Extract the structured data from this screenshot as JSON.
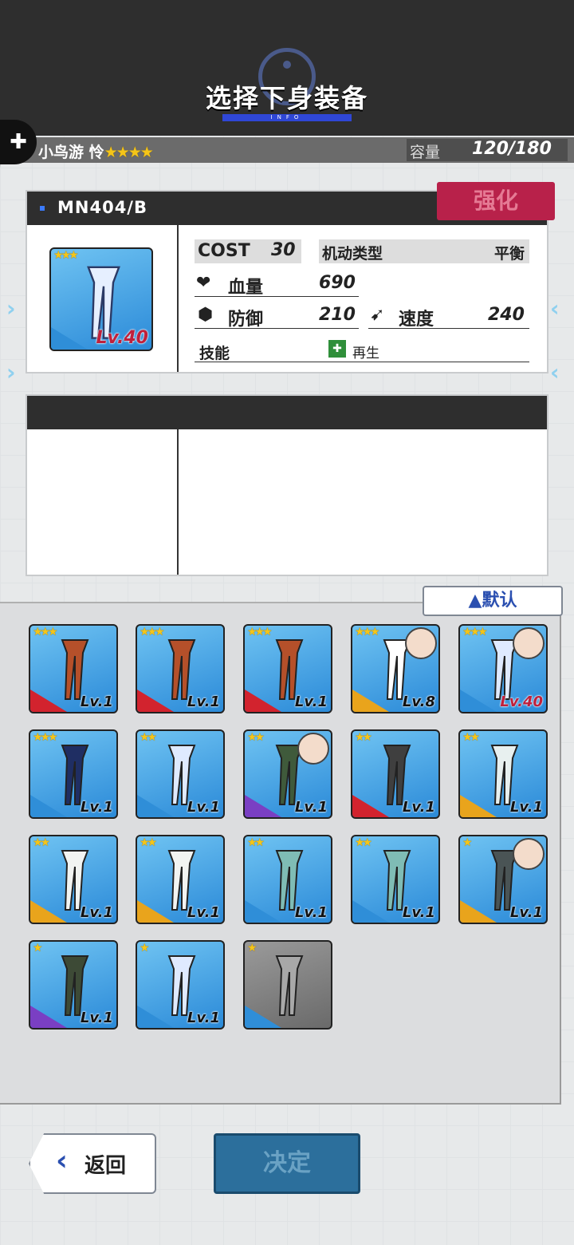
{
  "header": {
    "title": "选择下身装备",
    "subtitle": "INFO"
  },
  "pilot": {
    "name": "小鸟游 怜",
    "stars": "★★★★"
  },
  "capacity": {
    "label": "容量",
    "value": "120/180"
  },
  "detail": {
    "name": "MN404/B",
    "strengthen_label": "强化",
    "level": "Lv.40",
    "rarity": "★★★",
    "cost_label": "COST",
    "cost_value": "30",
    "mobility_label": "机动类型",
    "mobility_value": "平衡",
    "hp_label": "血量",
    "hp_value": "690",
    "def_label": "防御",
    "def_value": "210",
    "speed_label": "速度",
    "speed_value": "240",
    "skill_label": "技能",
    "skill_value": "再生"
  },
  "sort": {
    "label": "▲默认"
  },
  "items": [
    {
      "rarity": "★★★",
      "level": "Lv.1",
      "mark": "#d2232e",
      "color": "#b5502a",
      "equipped": false
    },
    {
      "rarity": "★★★",
      "level": "Lv.1",
      "mark": "#d2232e",
      "color": "#b5502a",
      "equipped": false
    },
    {
      "rarity": "★★★",
      "level": "Lv.1",
      "mark": "#d2232e",
      "color": "#b5502a",
      "equipped": false
    },
    {
      "rarity": "★★★",
      "level": "Lv.8",
      "mark": "#e9a41c",
      "color": "#ffffff",
      "equipped": true
    },
    {
      "rarity": "★★★",
      "level": "Lv.40",
      "mark": "#2f8ed8",
      "color": "#dfeaff",
      "equipped": true
    },
    {
      "rarity": "★★★",
      "level": "Lv.1",
      "mark": "#2f8ed8",
      "color": "#1f2e63",
      "equipped": false
    },
    {
      "rarity": "★★",
      "level": "Lv.1",
      "mark": "#2f8ed8",
      "color": "#dfeaff",
      "equipped": false
    },
    {
      "rarity": "★★",
      "level": "Lv.1",
      "mark": "#7a3fc3",
      "color": "#3f5a3b",
      "equipped": true
    },
    {
      "rarity": "★★",
      "level": "Lv.1",
      "mark": "#d2232e",
      "color": "#3f3f3f",
      "equipped": false
    },
    {
      "rarity": "★★",
      "level": "Lv.1",
      "mark": "#e9a41c",
      "color": "#e8f0ef",
      "equipped": false
    },
    {
      "rarity": "★★",
      "level": "Lv.1",
      "mark": "#e9a41c",
      "color": "#f2f4f2",
      "equipped": false
    },
    {
      "rarity": "★★",
      "level": "Lv.1",
      "mark": "#e9a41c",
      "color": "#f2f4f2",
      "equipped": false
    },
    {
      "rarity": "★★",
      "level": "Lv.1",
      "mark": "#2f8ed8",
      "color": "#7fbcb5",
      "equipped": false
    },
    {
      "rarity": "★★",
      "level": "Lv.1",
      "mark": "#2f8ed8",
      "color": "#7fbcb5",
      "equipped": false
    },
    {
      "rarity": "★",
      "level": "Lv.1",
      "mark": "#e9a41c",
      "color": "#4a5455",
      "equipped": true
    },
    {
      "rarity": "★",
      "level": "Lv.1",
      "mark": "#7a3fc3",
      "color": "#3d4a36",
      "equipped": false
    },
    {
      "rarity": "★",
      "level": "Lv.1",
      "mark": "#2f8ed8",
      "color": "#dfeaff",
      "equipped": false
    },
    {
      "rarity": "★",
      "level": "",
      "mark": "#2f8ed8",
      "color": "#a8a8a8",
      "equipped": false
    }
  ],
  "footer": {
    "back_label": "返回",
    "confirm_label": "决定"
  },
  "colors": {
    "accent": "#2f47d6",
    "strengthen": "#b8214a",
    "confirm": "#2c6f9c"
  }
}
